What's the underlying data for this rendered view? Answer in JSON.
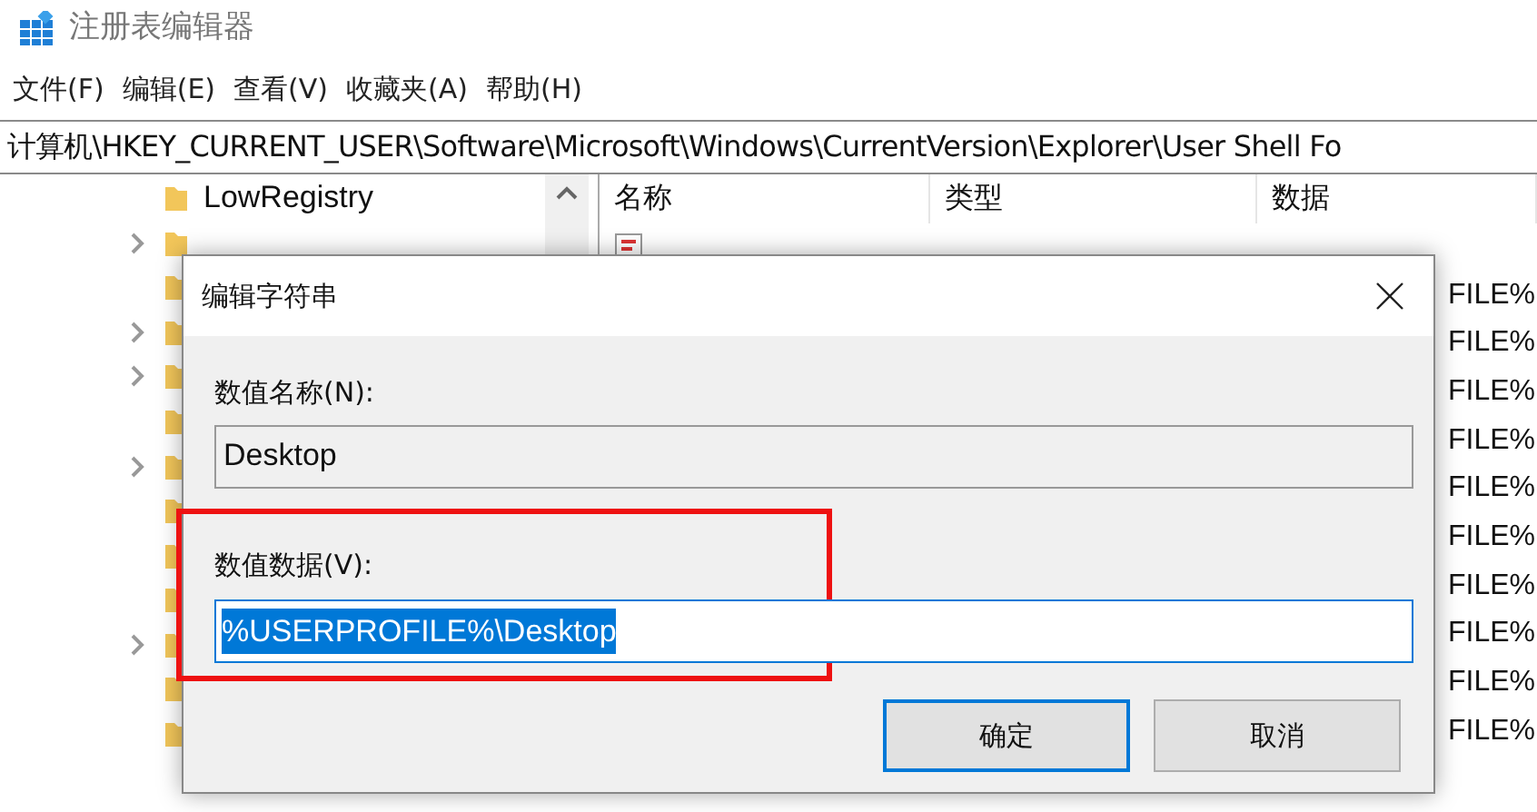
{
  "window": {
    "title": "注册表编辑器"
  },
  "menu": [
    "文件(F)",
    "编辑(E)",
    "查看(V)",
    "收藏夹(A)",
    "帮助(H)"
  ],
  "address": "计算机\\HKEY_CURRENT_USER\\Software\\Microsoft\\Windows\\CurrentVersion\\Explorer\\User Shell Fo",
  "tree": [
    {
      "label": "LowRegistry",
      "expandable": false
    },
    {
      "expandable": true
    },
    {
      "expandable": false
    },
    {
      "expandable": true
    },
    {
      "expandable": true
    },
    {
      "expandable": false
    },
    {
      "expandable": true
    },
    {
      "expandable": false
    },
    {
      "expandable": false
    },
    {
      "expandable": false
    },
    {
      "expandable": true
    },
    {
      "expandable": false
    },
    {
      "expandable": false
    }
  ],
  "list": {
    "columns": [
      "名称",
      "类型",
      "数据"
    ],
    "rows": [
      {
        "data": ""
      },
      {
        "data": "FILE%"
      },
      {
        "data": "FILE%"
      },
      {
        "data": "FILE%"
      },
      {
        "data": "FILE%"
      },
      {
        "data": "FILE%"
      },
      {
        "data": "FILE%"
      },
      {
        "data": "FILE%"
      },
      {
        "data": "FILE%"
      },
      {
        "data": "FILE%"
      },
      {
        "data": "FILE%"
      }
    ]
  },
  "dialog": {
    "title": "编辑字符串",
    "name_label": "数值名称(N):",
    "name_value": "Desktop",
    "data_label": "数值数据(V):",
    "data_value": "%USERPROFILE%\\Desktop",
    "buttons": [
      {
        "label": "确定",
        "default": true
      },
      {
        "label": "取消",
        "default": false
      }
    ]
  }
}
